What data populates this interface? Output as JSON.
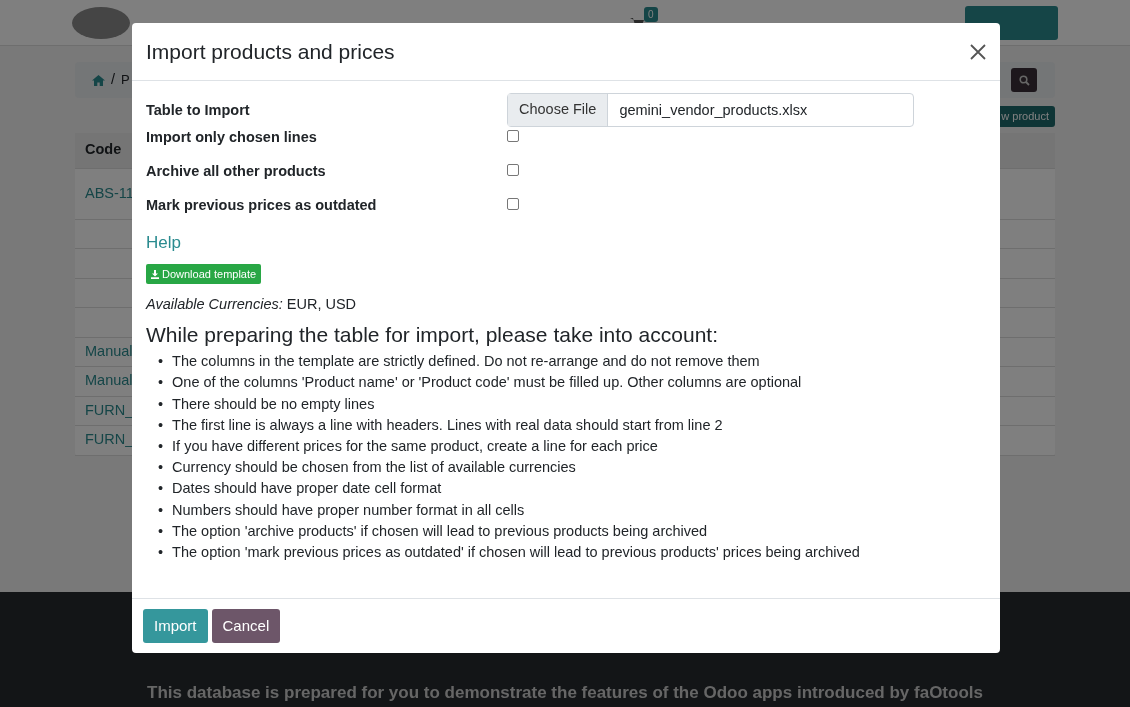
{
  "navbar": {
    "cart_count": "0"
  },
  "breadcrumb": {
    "separator": "/",
    "current": "P"
  },
  "new_button": "w product",
  "table": {
    "columns": [
      "Code"
    ],
    "rows": [
      "ABS-11",
      "",
      "",
      "",
      "",
      "Manual",
      "Manual",
      "FURN_",
      "FURN_"
    ]
  },
  "footer": {
    "text": "This database is prepared for you to demonstrate the features of the Odoo apps introduced by",
    "link": "faOtools"
  },
  "modal": {
    "title": "Import products and prices",
    "fields": [
      {
        "kind": "file",
        "label": "Table to Import",
        "button": "Choose File",
        "value": "gemini_vendor_products.xlsx"
      },
      {
        "kind": "checkbox",
        "label": "Import only chosen lines",
        "checked": false
      },
      {
        "kind": "checkbox",
        "label": "Archive all other products",
        "checked": false
      },
      {
        "kind": "checkbox",
        "label": "Mark previous prices as outdated",
        "checked": false
      }
    ],
    "help": "Help",
    "download": "Download template",
    "currencies": "*Available Currencies:* EUR, USD",
    "heading": "While preparing the table for import, please take into account:",
    "bullet": "•",
    "notes": [
      "The columns in the template are strictly defined. Do not re-arrange and do not remove them",
      "One of the columns 'Product name' or 'Product code' must be filled up. Other columns are optional",
      "There should be no empty lines",
      "The first line is always a line with headers. Lines with real data should start from line 2",
      "If you have different prices for the same product, create a line for each price",
      "Currency should be chosen from the list of available currencies",
      "Dates should have proper date cell format",
      "Numbers should have proper number format in all cells",
      "The option 'archive products' if chosen will lead to previous products being archived",
      "The option 'mark previous prices as outdated' if chosen will lead to previous products' prices being archived"
    ],
    "buttons": [
      {
        "label": "Import",
        "kind": "primary"
      },
      {
        "label": "Cancel",
        "kind": "secondary"
      }
    ]
  }
}
